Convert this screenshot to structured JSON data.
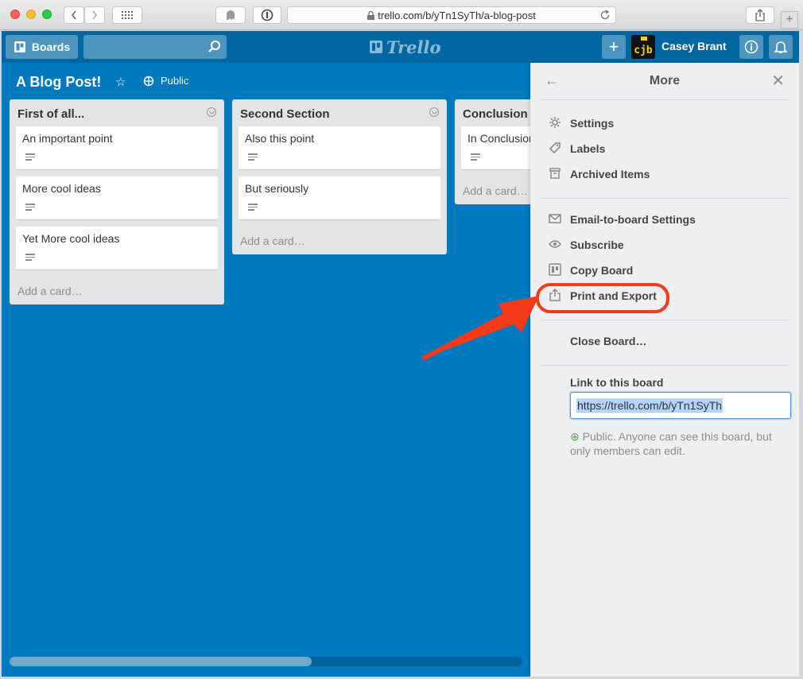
{
  "browser": {
    "url": "trello.com/b/yTn1SyTh/a-blog-post"
  },
  "header": {
    "boards_label": "Boards",
    "logo_text": "Trello",
    "avatar_initials": "cjb",
    "user_name": "Casey Brant"
  },
  "board": {
    "title": "A Blog Post!",
    "visibility": "Public"
  },
  "lists": [
    {
      "title": "First of all...",
      "cards": [
        "An important point",
        "More cool ideas",
        "Yet More cool ideas"
      ],
      "add_card": "Add a card…"
    },
    {
      "title": "Second Section",
      "cards": [
        "Also this point",
        "But seriously"
      ],
      "add_card": "Add a card…"
    },
    {
      "title": "Conclusion",
      "cards": [
        "In Conclusion"
      ],
      "add_card": "Add a card…"
    }
  ],
  "menu": {
    "title": "More",
    "group1": [
      {
        "label": "Settings",
        "icon": "gear-icon"
      },
      {
        "label": "Labels",
        "icon": "tag-icon"
      },
      {
        "label": "Archived Items",
        "icon": "archive-icon"
      }
    ],
    "group2": [
      {
        "label": "Email-to-board Settings",
        "icon": "envelope-icon"
      },
      {
        "label": "Subscribe",
        "icon": "eye-icon"
      },
      {
        "label": "Copy Board",
        "icon": "board-icon"
      },
      {
        "label": "Print and Export",
        "icon": "share-icon"
      }
    ],
    "close_board": "Close Board…",
    "link_label": "Link to this board",
    "link_value": "https://trello.com/b/yTn1SyTh",
    "public_note": "Public. Anyone can see this board, but only members can edit."
  },
  "colors": {
    "board_bg": "#0079bf",
    "header_bg": "#0067a3",
    "annotation": "#f53a1a"
  }
}
